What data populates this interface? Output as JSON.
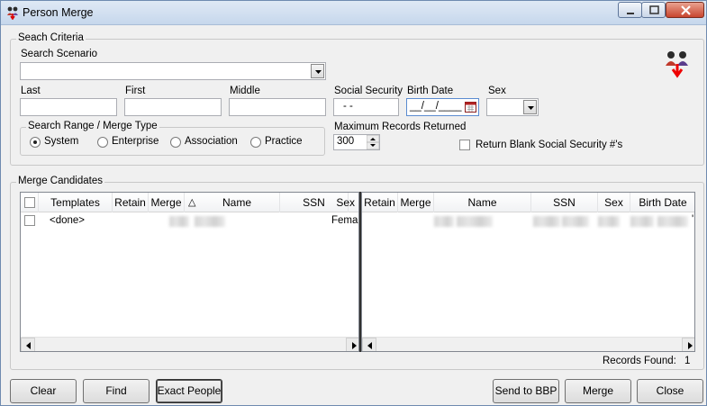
{
  "window": {
    "title": "Person Merge"
  },
  "search": {
    "legend": "Seach Criteria",
    "scenario_label": "Search Scenario",
    "scenario_value": "",
    "last_label": "Last",
    "first_label": "First",
    "middle_label": "Middle",
    "ssn_label": "Social Security",
    "ssn_value": " - -",
    "birth_label": "Birth Date",
    "birth_value": "__/__/____",
    "sex_label": "Sex",
    "sex_value": "",
    "range_legend": "Search Range / Merge Type",
    "range_options": [
      "System",
      "Enterprise",
      "Association",
      "Practice"
    ],
    "range_selected": "System",
    "max_label": "Maximum Records Returned",
    "max_value": "300",
    "blank_ssn_label": "Return Blank Social Security #'s"
  },
  "candidates": {
    "legend": "Merge Candidates",
    "left_headers": [
      "Templates",
      "Retain",
      "Merge",
      "△",
      "Name",
      "SSN",
      "Sex"
    ],
    "left_rows": [
      {
        "template": "<done>",
        "sex": "Fema"
      }
    ],
    "right_headers": [
      "Retain",
      "Merge",
      "Name",
      "SSN",
      "Sex",
      "Birth Date"
    ],
    "right_extra": "'",
    "records_label": "Records Found:",
    "records_count": "1"
  },
  "buttons": {
    "clear": "Clear",
    "find": "Find",
    "exact_people": "Exact People",
    "send_to_bbp": "Send to BBP",
    "merge": "Merge",
    "close": "Close"
  }
}
